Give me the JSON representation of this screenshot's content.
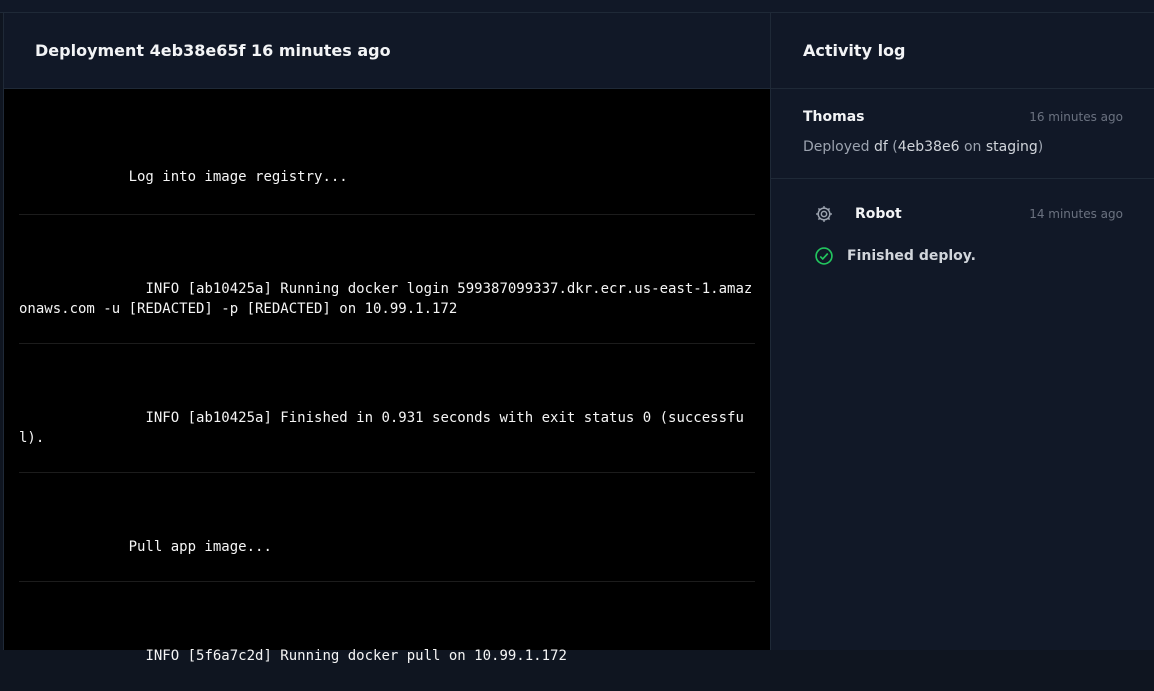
{
  "deployment": {
    "label": "Deployment",
    "id": "4eb38e65f",
    "time": "16 minutes ago"
  },
  "log_lines": [
    "             Log into image registry...",
    "               INFO [ab10425a] Running docker login 599387099337.dkr.ecr.us-east-1.amazonaws.com -u [REDACTED] -p [REDACTED] on 10.99.1.172",
    "               INFO [ab10425a] Finished in 0.931 seconds with exit status 0 (successful).",
    "             Pull app image...",
    "               INFO [5f6a7c2d] Running docker pull on 10.99.1.172"
  ],
  "activity": {
    "title": "Activity log",
    "entries": [
      {
        "actor": "Thomas",
        "time": "16 minutes ago",
        "action": "Deployed",
        "app": "df",
        "sha": "4eb38e6",
        "preposition": "on",
        "environment": "staging"
      },
      {
        "actor": "Robot",
        "time": "14 minutes ago",
        "status": "Finished deploy.",
        "actor_icon": "gear-icon",
        "status_icon": "check-circle-icon",
        "status_color": "#22c55e"
      }
    ]
  }
}
